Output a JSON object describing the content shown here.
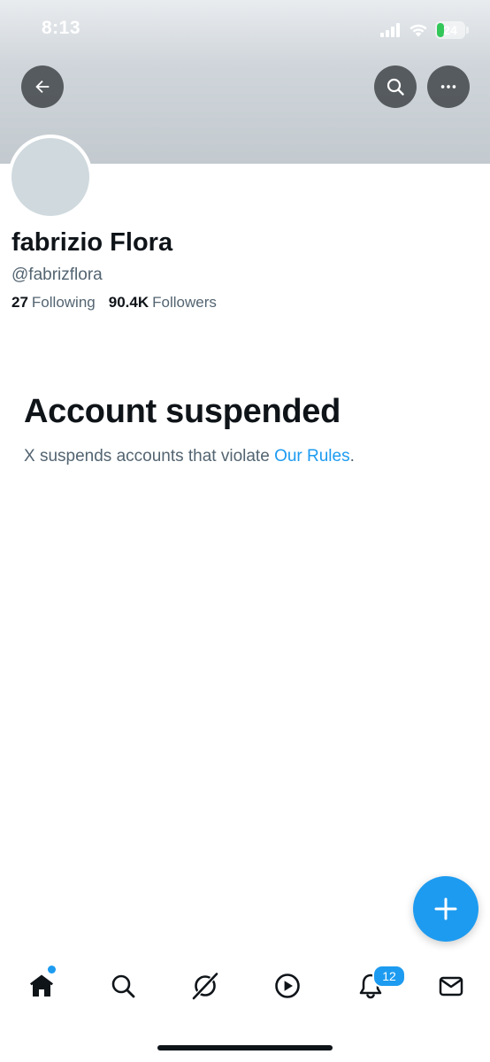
{
  "status_bar": {
    "time": "8:13",
    "battery_level": "24",
    "battery_charging": true,
    "icons": [
      "signal-icon",
      "wifi-icon",
      "battery-icon"
    ]
  },
  "header": {
    "back_icon": "arrow-left-icon",
    "search_icon": "search-icon",
    "more_icon": "more-horizontal-icon"
  },
  "profile": {
    "display_name": "fabrizio Flora",
    "handle": "@fabrizflora",
    "following_count": "27",
    "following_label": "Following",
    "followers_count": "90.4K",
    "followers_label": "Followers"
  },
  "suspension": {
    "title": "Account suspended",
    "description_prefix": "X suspends accounts that violate ",
    "rules_link": "Our Rules",
    "description_suffix": "."
  },
  "fab": {
    "icon": "plus-icon"
  },
  "bottom_nav": {
    "items": [
      {
        "name": "home",
        "icon": "home-icon",
        "active": true
      },
      {
        "name": "search",
        "icon": "search-icon"
      },
      {
        "name": "grok",
        "icon": "grok-icon"
      },
      {
        "name": "video",
        "icon": "play-circle-icon"
      },
      {
        "name": "notifications",
        "icon": "bell-icon",
        "badge": "12"
      },
      {
        "name": "messages",
        "icon": "envelope-icon"
      }
    ]
  },
  "colors": {
    "accent": "#1d9bf0",
    "text_primary": "#0f1419",
    "text_secondary": "#536471",
    "avatar_placeholder": "#cfd9de"
  }
}
